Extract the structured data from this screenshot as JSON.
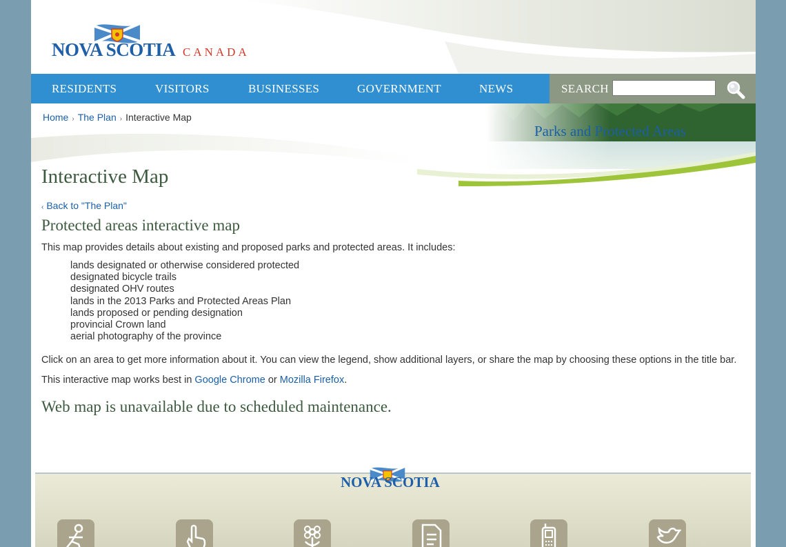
{
  "header": {
    "logo_text": "NOVA SCOTIA",
    "logo_suffix": "CANADA"
  },
  "nav": {
    "items": [
      {
        "label": "RESIDENTS"
      },
      {
        "label": "VISITORS"
      },
      {
        "label": "BUSINESSES"
      },
      {
        "label": "GOVERNMENT"
      },
      {
        "label": "NEWS"
      }
    ],
    "search_label": "SEARCH",
    "search_value": ""
  },
  "breadcrumb": {
    "items": [
      {
        "label": "Home"
      },
      {
        "label": "The Plan"
      },
      {
        "label": "Interactive Map"
      }
    ]
  },
  "section_title": "Parks and Protected Areas",
  "content": {
    "page_title": "Interactive Map",
    "back_link": "Back to \"The Plan\"",
    "sub_title": "Protected areas interactive map",
    "intro": "This map provides details about existing and proposed parks and protected areas. It includes:",
    "features": [
      "lands designated or otherwise considered protected",
      "designated bicycle trails",
      "designated OHV routes",
      "lands in the 2013 Parks and Protected Areas Plan",
      "lands proposed or pending designation",
      "provincial Crown land",
      "aerial photography of the province"
    ],
    "click_info": "Click on an area to get more information about it. You can view the legend, show additional layers, or share the map by choosing these options in the title bar.",
    "browser_prefix": "This interactive map works best in",
    "browser_chrome": "Google Chrome",
    "browser_or": "or",
    "browser_firefox": "Mozilla Firefox",
    "browser_suffix": ".",
    "maintenance": "Web map is unavailable due to scheduled maintenance."
  },
  "footer": {
    "logo_text": "NOVA SCOTIA",
    "icons": [
      "person-reading-icon",
      "hand-pointer-icon",
      "flower-icon",
      "document-icon",
      "mobile-phone-icon",
      "bird-icon"
    ]
  },
  "colors": {
    "page_bg": "#7b9db0",
    "nav_bg": "#2f8fd1",
    "search_bg": "#8c9784",
    "link": "#1a5fa8",
    "heading": "#3c5a3e",
    "brand_red": "#d43a2b"
  }
}
